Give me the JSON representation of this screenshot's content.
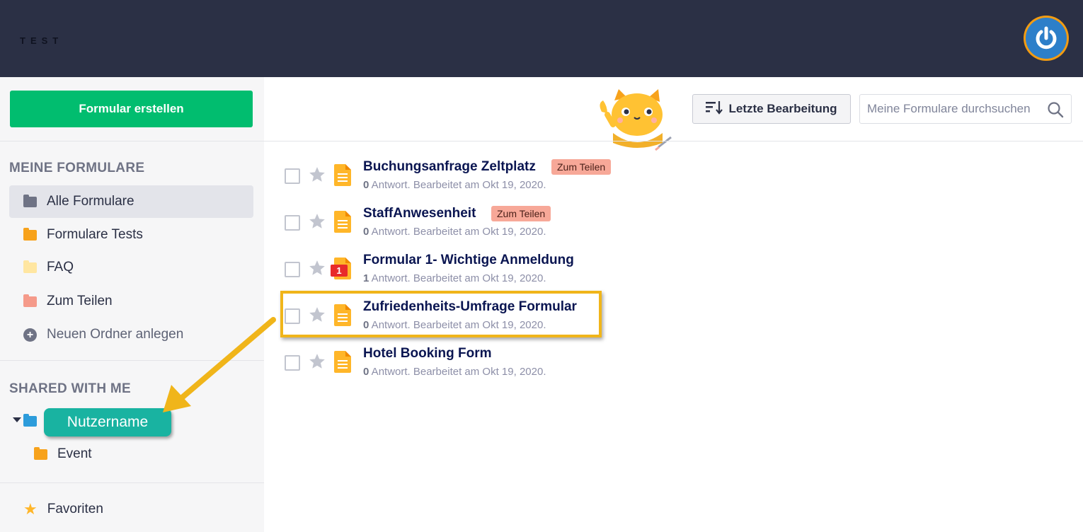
{
  "header": {
    "brand": "TEST"
  },
  "sidebar": {
    "create_button": "Formular erstellen",
    "my_forms_title": "MEINE FORMULARE",
    "folders": [
      {
        "label": "Alle Formulare",
        "color": "#6f7385"
      },
      {
        "label": "Formulare Tests",
        "color": "#f7a21b"
      },
      {
        "label": "FAQ",
        "color": "#ffe6a1"
      },
      {
        "label": "Zum Teilen",
        "color": "#f59a8a"
      }
    ],
    "new_folder_label": "Neuen Ordner anlegen",
    "shared_title": "SHARED WITH ME",
    "shared_user": "Nutzername",
    "shared_subfolder": "Event",
    "favorites_label": "Favoriten"
  },
  "toolbar": {
    "sort_label": "Letzte Bearbeitung",
    "search_placeholder": "Meine Formulare durchsuchen"
  },
  "forms": [
    {
      "title": "Buchungsanfrage Zeltplatz",
      "tag": "Zum Teilen",
      "count": "0",
      "meta": " Antwort. Bearbeitet am Okt 19, 2020."
    },
    {
      "title": "StaffAnwesenheit",
      "tag": "Zum Teilen",
      "count": "0",
      "meta": " Antwort. Bearbeitet am Okt 19, 2020."
    },
    {
      "title": "Formular 1- Wichtige Anmeldung",
      "badge": "1",
      "count": "1",
      "meta": " Antwort. Bearbeitet am Okt 19, 2020."
    },
    {
      "title": "Zufriedenheits-Umfrage Formular",
      "count": "0",
      "meta": " Antwort. Bearbeitet am Okt 19, 2020."
    },
    {
      "title": "Hotel Booking Form",
      "count": "0",
      "meta": " Antwort. Bearbeitet am Okt 19, 2020."
    }
  ],
  "colors": {
    "topbar": "#2b3045",
    "create_button": "#01bd6f",
    "highlight": "#f0b51a",
    "username_pill": "#19b3a1",
    "tag": "#f7a898"
  }
}
